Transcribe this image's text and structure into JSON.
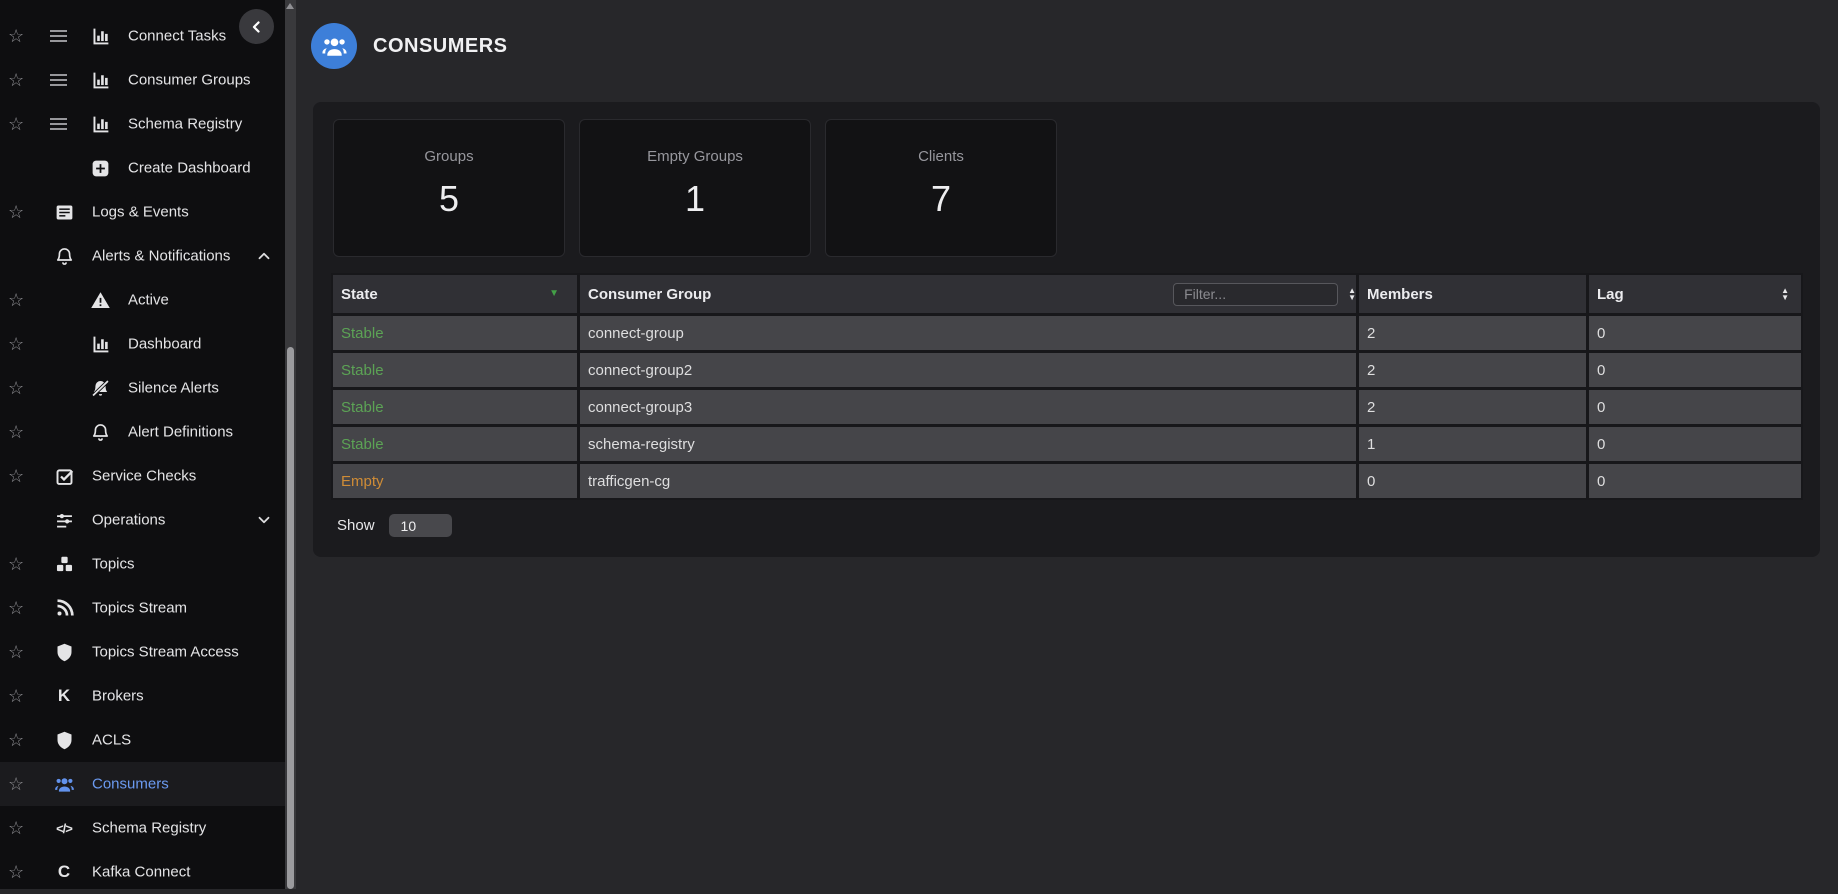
{
  "header": {
    "title": "CONSUMERS"
  },
  "sidebar": {
    "items": [
      {
        "label": "Connect Tasks",
        "icon": "bar-chart",
        "star": true,
        "drag": true,
        "indent": 2
      },
      {
        "label": "Consumer Groups",
        "icon": "bar-chart",
        "star": true,
        "drag": true,
        "indent": 2
      },
      {
        "label": "Schema Registry",
        "icon": "bar-chart",
        "star": true,
        "drag": true,
        "indent": 2
      },
      {
        "label": "Create Dashboard",
        "icon": "plus-square",
        "star": false,
        "drag": false,
        "indent": 2
      },
      {
        "label": "Logs & Events",
        "icon": "list",
        "star": true,
        "drag": false,
        "indent": 1
      },
      {
        "label": "Alerts & Notifications",
        "icon": "bell",
        "star": false,
        "drag": false,
        "indent": 1,
        "chevron": "up"
      },
      {
        "label": "Active",
        "icon": "warning",
        "star": true,
        "drag": false,
        "indent": 2
      },
      {
        "label": "Dashboard",
        "icon": "bar-chart",
        "star": true,
        "drag": false,
        "indent": 2
      },
      {
        "label": "Silence Alerts",
        "icon": "bell-slash",
        "star": true,
        "drag": false,
        "indent": 2
      },
      {
        "label": "Alert Definitions",
        "icon": "bell",
        "star": true,
        "drag": false,
        "indent": 2
      },
      {
        "label": "Service Checks",
        "icon": "checkbox",
        "star": true,
        "drag": false,
        "indent": 1
      },
      {
        "label": "Operations",
        "icon": "sliders",
        "star": false,
        "drag": false,
        "indent": 1,
        "chevron": "down"
      },
      {
        "label": "Topics",
        "icon": "cubes",
        "star": true,
        "drag": false,
        "indent": 1
      },
      {
        "label": "Topics Stream",
        "icon": "rss",
        "star": true,
        "drag": false,
        "indent": 1
      },
      {
        "label": "Topics Stream Access",
        "icon": "shield",
        "star": true,
        "drag": false,
        "indent": 1
      },
      {
        "label": "Brokers",
        "icon": "letter-k",
        "star": true,
        "drag": false,
        "indent": 1
      },
      {
        "label": "ACLS",
        "icon": "shield",
        "star": true,
        "drag": false,
        "indent": 1
      },
      {
        "label": "Consumers",
        "icon": "users",
        "star": true,
        "drag": false,
        "indent": 1,
        "selected": true
      },
      {
        "label": "Schema Registry",
        "icon": "code",
        "star": true,
        "drag": false,
        "indent": 1
      },
      {
        "label": "Kafka Connect",
        "icon": "letter-c",
        "star": true,
        "drag": false,
        "indent": 1
      }
    ]
  },
  "stats": [
    {
      "label": "Groups",
      "value": "5"
    },
    {
      "label": "Empty Groups",
      "value": "1"
    },
    {
      "label": "Clients",
      "value": "7"
    }
  ],
  "table": {
    "columns": {
      "state": "State",
      "consumer_group": "Consumer Group",
      "members": "Members",
      "lag": "Lag"
    },
    "filter_placeholder": "Filter...",
    "rows": [
      {
        "state": "Stable",
        "state_color": "green",
        "group": "connect-group",
        "members": "2",
        "lag": "0"
      },
      {
        "state": "Stable",
        "state_color": "green",
        "group": "connect-group2",
        "members": "2",
        "lag": "0"
      },
      {
        "state": "Stable",
        "state_color": "green",
        "group": "connect-group3",
        "members": "2",
        "lag": "0"
      },
      {
        "state": "Stable",
        "state_color": "green",
        "group": "schema-registry",
        "members": "1",
        "lag": "0"
      },
      {
        "state": "Empty",
        "state_color": "orange",
        "group": "trafficgen-cg",
        "members": "0",
        "lag": "0"
      }
    ],
    "show_label": "Show",
    "page_size": "10"
  },
  "colors": {
    "accent_blue": "#3d7fd9",
    "sidebar_selected_blue": "#6b9af0",
    "sidebar_icon_blue": "#6292ec",
    "state_stable_green": "#5ca355",
    "state_empty_orange": "#cf8c36",
    "sort_active_green": "#43a047"
  }
}
